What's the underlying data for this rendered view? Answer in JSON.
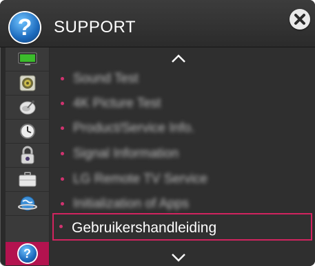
{
  "header": {
    "title": "SUPPORT",
    "help_glyph": "?",
    "help_icon": "question-circle-icon",
    "close_icon": "close-icon"
  },
  "sidebar": {
    "items": [
      {
        "icon": "monitor-icon"
      },
      {
        "icon": "speaker-icon"
      },
      {
        "icon": "satellite-dish-icon"
      },
      {
        "icon": "clock-icon"
      },
      {
        "icon": "lock-icon"
      },
      {
        "icon": "briefcase-icon"
      },
      {
        "icon": "globe-network-icon"
      },
      {
        "icon": "question-circle-icon",
        "active": true,
        "glyph": "?"
      }
    ]
  },
  "list": {
    "items": [
      {
        "label": "Sound Test",
        "blurred": true
      },
      {
        "label": "4K Picture Test",
        "blurred": true
      },
      {
        "label": "Product/Service Info.",
        "blurred": true
      },
      {
        "label": "Signal Information",
        "blurred": true
      },
      {
        "label": "LG Remote TV Service",
        "blurred": true
      },
      {
        "label": "Initialization of Apps",
        "blurred": true
      },
      {
        "label": "Gebruikershandleiding",
        "blurred": false,
        "selected": true
      }
    ]
  },
  "colors": {
    "accent": "#d2245f",
    "active_tab": "#b3134f",
    "panel": "#2f2f2f",
    "header": "#3c3c3c"
  }
}
